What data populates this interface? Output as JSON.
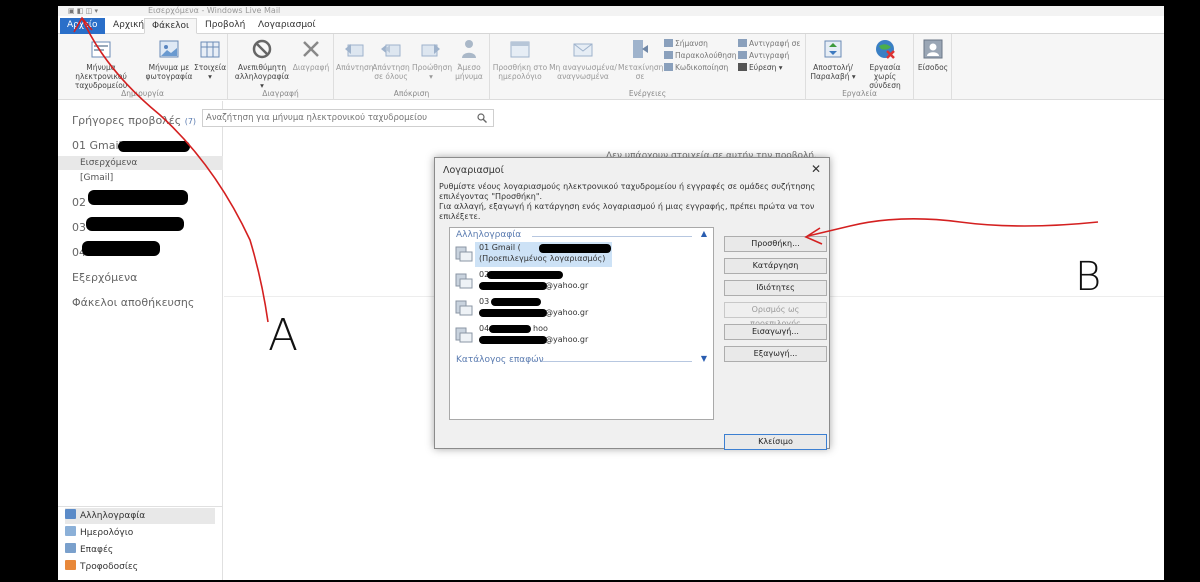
{
  "app": {
    "title": "Εισερχόμενα - Windows Live Mail"
  },
  "tabs": [
    {
      "label": "Αρχείο"
    },
    {
      "label": "Αρχική"
    },
    {
      "label": "Φάκελοι"
    },
    {
      "label": "Προβολή"
    },
    {
      "label": "Λογαριασμοί"
    }
  ],
  "ribbon": {
    "groups": {
      "create": "Δημιουργία",
      "delete": "Διαγραφή",
      "respond": "Απόκριση",
      "actions": "Ενέργειες",
      "tools": "Εργαλεία"
    },
    "buttons": {
      "new_email_l1": "Μήνυμα ηλεκτρονικού",
      "new_email_l2": "ταχυδρομείου",
      "photo_email_l1": "Μήνυμα με",
      "photo_email_l2": "φωτογραφία",
      "items_l1": "Στοιχεία",
      "items_l2": "▾",
      "junk_l1": "Ανεπιθύμητη",
      "junk_l2": "αλληλογραφία ▾",
      "delete": "Διαγραφή",
      "reply": "Απάντηση",
      "reply_all_l1": "Απάντηση",
      "reply_all_l2": "σε όλους",
      "forward_l1": "Προώθηση",
      "forward_l2": "▾",
      "im_l1": "Άμεσο",
      "im_l2": "μήνυμα",
      "add_calendar_l1": "Προσθήκη στο",
      "add_calendar_l2": "ημερολόγιο",
      "unread_l1": "Μη αναγνωσμένα/",
      "unread_l2": "αναγνωσμένα",
      "move_l1": "Μετακίνηση",
      "move_l2": "σε",
      "flag": "Σήμανση",
      "watch": "Παρακολούθηση",
      "encoding": "Κωδικοποίηση",
      "copy_to": "Αντιγραφή σε",
      "copy": "Αντιγραφή",
      "find": "Εύρεση ▾",
      "send_receive_l1": "Αποστολή/",
      "send_receive_l2": "Παραλαβή ▾",
      "offline_l1": "Εργασία χωρίς",
      "offline_l2": "σύνδεση",
      "signin": "Είσοδος"
    }
  },
  "left": {
    "quick_views": "Γρήγορες προβολές",
    "quick_views_count": "(7)",
    "account1": "01 Gmail",
    "inbox": "Εισερχόμενα",
    "gmail_folder": "[Gmail]",
    "account2": "02",
    "account3": "03",
    "account4": "04",
    "outbox": "Εξερχόμενα",
    "storage": "Φάκελοι αποθήκευσης",
    "nav": {
      "mail": "Αλληλογραφία",
      "calendar": "Ημερολόγιο",
      "contacts": "Επαφές",
      "feeds": "Τροφοδοσίες"
    }
  },
  "search": {
    "placeholder": "Αναζήτηση για μήνυμα ηλεκτρονικού ταχυδρομείου"
  },
  "content": {
    "empty_text": "Δεν υπάρχουν στοιχεία σε αυτήν την προβολή."
  },
  "dialog": {
    "title": "Λογαριασμοί",
    "description": "Ρυθμίστε νέους λογαριασμούς ηλεκτρονικού ταχυδρομείου ή εγγραφές σε ομάδες συζήτησης επιλέγοντας \"Προσθήκη\".",
    "description2": "Για αλλαγή, εξαγωγή ή κατάργηση ενός λογαριασμού ή μιας εγγραφής, πρέπει πρώτα να τον επιλέξετε.",
    "mail_category": "Αλληλογραφία",
    "contacts_category": "Κατάλογος επαφών",
    "accounts": [
      {
        "l1": "01 Gmail (",
        "l2": "(Προεπιλεγμένος λογαριασμός)"
      },
      {
        "l1": "02",
        "l2": "@yahoo.gr"
      },
      {
        "l1": "03",
        "l2": "@yahoo.gr"
      },
      {
        "l1": "04",
        "l2": "@yahoo.gr",
        "l1b": "hoo"
      }
    ],
    "buttons": {
      "add": "Προσθήκη...",
      "remove": "Κατάργηση",
      "properties": "Ιδιότητες",
      "set_default": "Ορισμός ως προεπιλογής",
      "import": "Εισαγωγή...",
      "export": "Εξαγωγή...",
      "close": "Κλείσιμο"
    }
  },
  "annotations": {
    "a": "A",
    "b": "B",
    "color": "#d42020"
  }
}
